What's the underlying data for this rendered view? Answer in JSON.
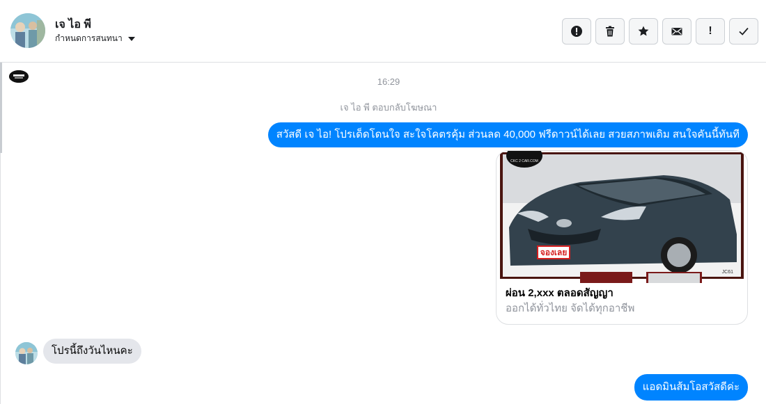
{
  "header": {
    "contact_name": "เจ ไอ พี",
    "subtitle": "กำหนดการสนทนา",
    "actions": [
      {
        "name": "report-button",
        "icon": "exclamation-circle-icon"
      },
      {
        "name": "delete-button",
        "icon": "trash-icon"
      },
      {
        "name": "star-button",
        "icon": "star-icon"
      },
      {
        "name": "mark-unread-button",
        "icon": "envelope-icon"
      },
      {
        "name": "flag-button",
        "icon": "exclamation-icon",
        "label": "!"
      },
      {
        "name": "mark-done-button",
        "icon": "check-icon"
      }
    ]
  },
  "conversation": {
    "timestamp": "16:29",
    "replied_note": "เจ ไอ พี ตอบกลับโฆษณา",
    "messages": [
      {
        "direction": "outgoing",
        "text": "สวัสดี เจ ไอ! โปรเด็ดโดนใจ สะใจโคตรคุ้ม ส่วนลด 40,000 ฟรีดาวน์ได้เลย สวยสภาพเดิม สนใจคันนี้ทันที"
      },
      {
        "direction": "incoming",
        "text": "โปรนี้ถึงวันไหนคะ"
      },
      {
        "direction": "outgoing",
        "text": "แอดมินส้มโอสวัสดีค่ะ"
      }
    ],
    "ad_card": {
      "title": "ผ่อน 2,xxx ตลอดสัญญา",
      "subtitle": "ออกได้ทั่วไทย จัดได้ทุกอาชีพ",
      "badge_text": "จองเลย",
      "logo_text": "CKC 2 CAR.COM",
      "corner_code": "JC61"
    }
  },
  "colors": {
    "outgoing_bubble": "#0084ff",
    "incoming_bubble": "#e4e6eb",
    "muted_text": "#90949c"
  }
}
